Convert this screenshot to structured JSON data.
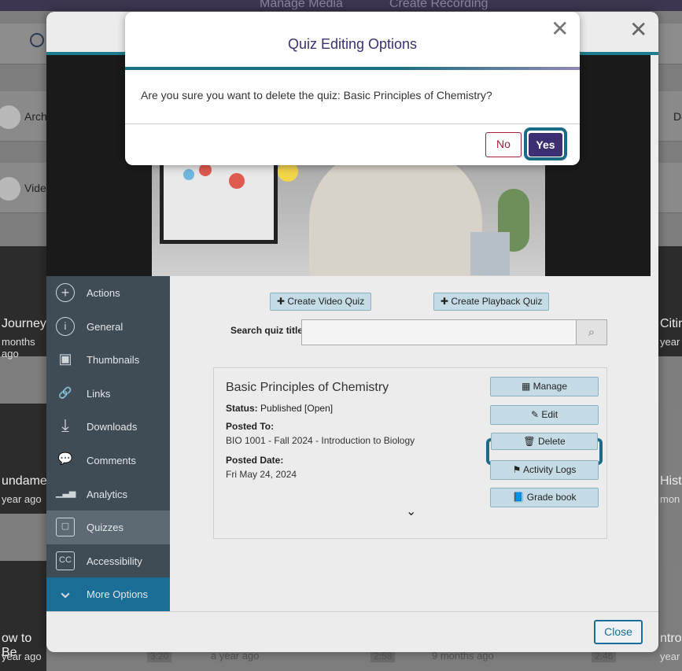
{
  "background": {
    "top_links": [
      "Manage Media",
      "Create Recording"
    ],
    "rows": [
      "Arch",
      "Vide"
    ],
    "right_rows": [
      "De"
    ],
    "cards": [
      {
        "title": "Journey",
        "sub": "months ago"
      },
      {
        "title": "undamen",
        "sub": "year ago"
      },
      {
        "title": "ow to Be",
        "sub": "year ago"
      },
      {
        "title": "Citing",
        "sub": "year"
      },
      {
        "title": "Histo",
        "sub": "mon"
      },
      {
        "title": "ntro",
        "sub": "year"
      }
    ],
    "bottom_labels": [
      "a year ago",
      "9 months ago"
    ],
    "durations": [
      "3:20",
      "2:58",
      "2:46"
    ]
  },
  "media_modal": {
    "close_icon": "close-icon",
    "sidebar": [
      {
        "label": "Actions",
        "icon": "plus-circle-icon",
        "glyph": "+"
      },
      {
        "label": "General",
        "icon": "info-icon",
        "glyph": "i"
      },
      {
        "label": "Thumbnails",
        "icon": "thumbnails-icon",
        "glyph": "▣"
      },
      {
        "label": "Links",
        "icon": "link-icon",
        "glyph": "🔗"
      },
      {
        "label": "Downloads",
        "icon": "download-icon",
        "glyph": "⤓"
      },
      {
        "label": "Comments",
        "icon": "comments-icon",
        "glyph": "💬"
      },
      {
        "label": "Analytics",
        "icon": "analytics-icon",
        "glyph": "▁▃▅"
      },
      {
        "label": "Quizzes",
        "icon": "quiz-icon",
        "glyph": "▢"
      },
      {
        "label": "Accessibility",
        "icon": "cc-icon",
        "glyph": "CC"
      },
      {
        "label": "More Options",
        "icon": "chevron-down-icon",
        "glyph": "⌄"
      }
    ],
    "active_item": "Quizzes",
    "create_video_quiz": "Create Video Quiz",
    "create_playback_quiz": "Create Playback Quiz",
    "search_label": "Search quiz title",
    "search_value": "",
    "quiz": {
      "title": "Basic Principles of Chemistry",
      "status_label": "Status:",
      "status_value": "Published [Open]",
      "posted_to_label": "Posted To:",
      "posted_to_value": "BIO 1001 - Fall 2024 - Introduction to Biology",
      "posted_date_label": "Posted Date:",
      "posted_date_value": "Fri May 24, 2024",
      "actions": {
        "manage": "Manage",
        "edit": "Edit",
        "delete": "Delete",
        "activity_logs": "Activity Logs",
        "grade_book": "Grade book"
      }
    },
    "close_label": "Close"
  },
  "dialog": {
    "title": "Quiz Editing Options",
    "message": "Are you sure you want to delete the quiz: Basic Principles of Chemistry?",
    "no_label": "No",
    "yes_label": "Yes"
  },
  "colors": {
    "accent_teal": "#1c6b86",
    "dialog_title": "#3d2f72",
    "no_red": "#a3203e",
    "sidebar": "#3f4b55"
  }
}
